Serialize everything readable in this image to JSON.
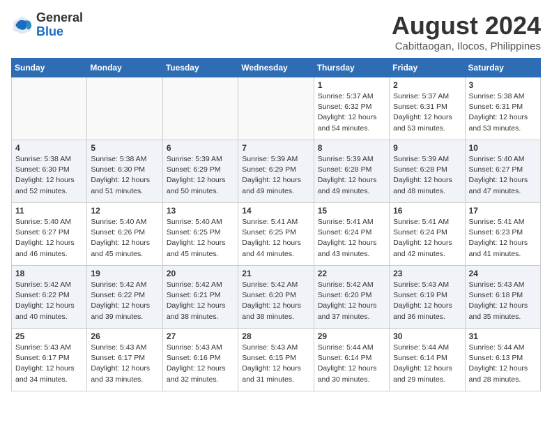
{
  "header": {
    "logo": {
      "line1": "General",
      "line2": "Blue"
    },
    "title": "August 2024",
    "location": "Cabittaogan, Ilocos, Philippines"
  },
  "days_of_week": [
    "Sunday",
    "Monday",
    "Tuesday",
    "Wednesday",
    "Thursday",
    "Friday",
    "Saturday"
  ],
  "weeks": [
    [
      {
        "day": "",
        "info": ""
      },
      {
        "day": "",
        "info": ""
      },
      {
        "day": "",
        "info": ""
      },
      {
        "day": "",
        "info": ""
      },
      {
        "day": "1",
        "info": "Sunrise: 5:37 AM\nSunset: 6:32 PM\nDaylight: 12 hours\nand 54 minutes."
      },
      {
        "day": "2",
        "info": "Sunrise: 5:37 AM\nSunset: 6:31 PM\nDaylight: 12 hours\nand 53 minutes."
      },
      {
        "day": "3",
        "info": "Sunrise: 5:38 AM\nSunset: 6:31 PM\nDaylight: 12 hours\nand 53 minutes."
      }
    ],
    [
      {
        "day": "4",
        "info": "Sunrise: 5:38 AM\nSunset: 6:30 PM\nDaylight: 12 hours\nand 52 minutes."
      },
      {
        "day": "5",
        "info": "Sunrise: 5:38 AM\nSunset: 6:30 PM\nDaylight: 12 hours\nand 51 minutes."
      },
      {
        "day": "6",
        "info": "Sunrise: 5:39 AM\nSunset: 6:29 PM\nDaylight: 12 hours\nand 50 minutes."
      },
      {
        "day": "7",
        "info": "Sunrise: 5:39 AM\nSunset: 6:29 PM\nDaylight: 12 hours\nand 49 minutes."
      },
      {
        "day": "8",
        "info": "Sunrise: 5:39 AM\nSunset: 6:28 PM\nDaylight: 12 hours\nand 49 minutes."
      },
      {
        "day": "9",
        "info": "Sunrise: 5:39 AM\nSunset: 6:28 PM\nDaylight: 12 hours\nand 48 minutes."
      },
      {
        "day": "10",
        "info": "Sunrise: 5:40 AM\nSunset: 6:27 PM\nDaylight: 12 hours\nand 47 minutes."
      }
    ],
    [
      {
        "day": "11",
        "info": "Sunrise: 5:40 AM\nSunset: 6:27 PM\nDaylight: 12 hours\nand 46 minutes."
      },
      {
        "day": "12",
        "info": "Sunrise: 5:40 AM\nSunset: 6:26 PM\nDaylight: 12 hours\nand 45 minutes."
      },
      {
        "day": "13",
        "info": "Sunrise: 5:40 AM\nSunset: 6:25 PM\nDaylight: 12 hours\nand 45 minutes."
      },
      {
        "day": "14",
        "info": "Sunrise: 5:41 AM\nSunset: 6:25 PM\nDaylight: 12 hours\nand 44 minutes."
      },
      {
        "day": "15",
        "info": "Sunrise: 5:41 AM\nSunset: 6:24 PM\nDaylight: 12 hours\nand 43 minutes."
      },
      {
        "day": "16",
        "info": "Sunrise: 5:41 AM\nSunset: 6:24 PM\nDaylight: 12 hours\nand 42 minutes."
      },
      {
        "day": "17",
        "info": "Sunrise: 5:41 AM\nSunset: 6:23 PM\nDaylight: 12 hours\nand 41 minutes."
      }
    ],
    [
      {
        "day": "18",
        "info": "Sunrise: 5:42 AM\nSunset: 6:22 PM\nDaylight: 12 hours\nand 40 minutes."
      },
      {
        "day": "19",
        "info": "Sunrise: 5:42 AM\nSunset: 6:22 PM\nDaylight: 12 hours\nand 39 minutes."
      },
      {
        "day": "20",
        "info": "Sunrise: 5:42 AM\nSunset: 6:21 PM\nDaylight: 12 hours\nand 38 minutes."
      },
      {
        "day": "21",
        "info": "Sunrise: 5:42 AM\nSunset: 6:20 PM\nDaylight: 12 hours\nand 38 minutes."
      },
      {
        "day": "22",
        "info": "Sunrise: 5:42 AM\nSunset: 6:20 PM\nDaylight: 12 hours\nand 37 minutes."
      },
      {
        "day": "23",
        "info": "Sunrise: 5:43 AM\nSunset: 6:19 PM\nDaylight: 12 hours\nand 36 minutes."
      },
      {
        "day": "24",
        "info": "Sunrise: 5:43 AM\nSunset: 6:18 PM\nDaylight: 12 hours\nand 35 minutes."
      }
    ],
    [
      {
        "day": "25",
        "info": "Sunrise: 5:43 AM\nSunset: 6:17 PM\nDaylight: 12 hours\nand 34 minutes."
      },
      {
        "day": "26",
        "info": "Sunrise: 5:43 AM\nSunset: 6:17 PM\nDaylight: 12 hours\nand 33 minutes."
      },
      {
        "day": "27",
        "info": "Sunrise: 5:43 AM\nSunset: 6:16 PM\nDaylight: 12 hours\nand 32 minutes."
      },
      {
        "day": "28",
        "info": "Sunrise: 5:43 AM\nSunset: 6:15 PM\nDaylight: 12 hours\nand 31 minutes."
      },
      {
        "day": "29",
        "info": "Sunrise: 5:44 AM\nSunset: 6:14 PM\nDaylight: 12 hours\nand 30 minutes."
      },
      {
        "day": "30",
        "info": "Sunrise: 5:44 AM\nSunset: 6:14 PM\nDaylight: 12 hours\nand 29 minutes."
      },
      {
        "day": "31",
        "info": "Sunrise: 5:44 AM\nSunset: 6:13 PM\nDaylight: 12 hours\nand 28 minutes."
      }
    ]
  ]
}
